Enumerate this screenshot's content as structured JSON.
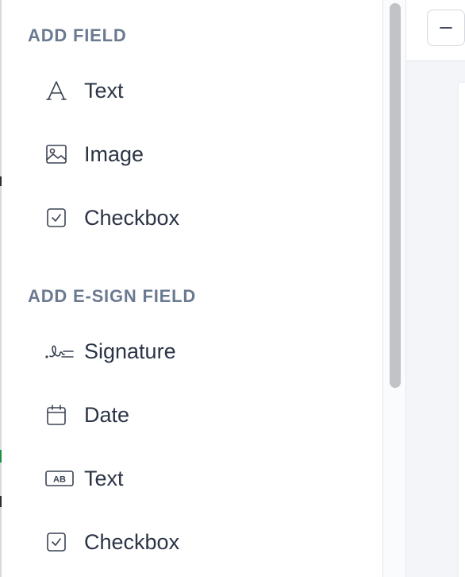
{
  "sections": [
    {
      "title": "ADD FIELD",
      "items": [
        {
          "label": "Text",
          "icon": "text-font-icon"
        },
        {
          "label": "Image",
          "icon": "image-icon"
        },
        {
          "label": "Checkbox",
          "icon": "checkbox-icon"
        }
      ]
    },
    {
      "title": "ADD E-SIGN FIELD",
      "items": [
        {
          "label": "Signature",
          "icon": "signature-icon"
        },
        {
          "label": "Date",
          "icon": "calendar-icon"
        },
        {
          "label": "Text",
          "icon": "ab-textbox-icon"
        },
        {
          "label": "Checkbox",
          "icon": "checkbox-icon"
        }
      ]
    }
  ],
  "toolbar": {
    "zoom_out_icon": "minus-icon"
  },
  "colors": {
    "section_title": "#6b7a90",
    "item_text": "#2b3445",
    "icon_stroke": "#3a4352",
    "scroll_thumb": "#c1c3c7",
    "canvas_bg": "#f3f5f8"
  }
}
